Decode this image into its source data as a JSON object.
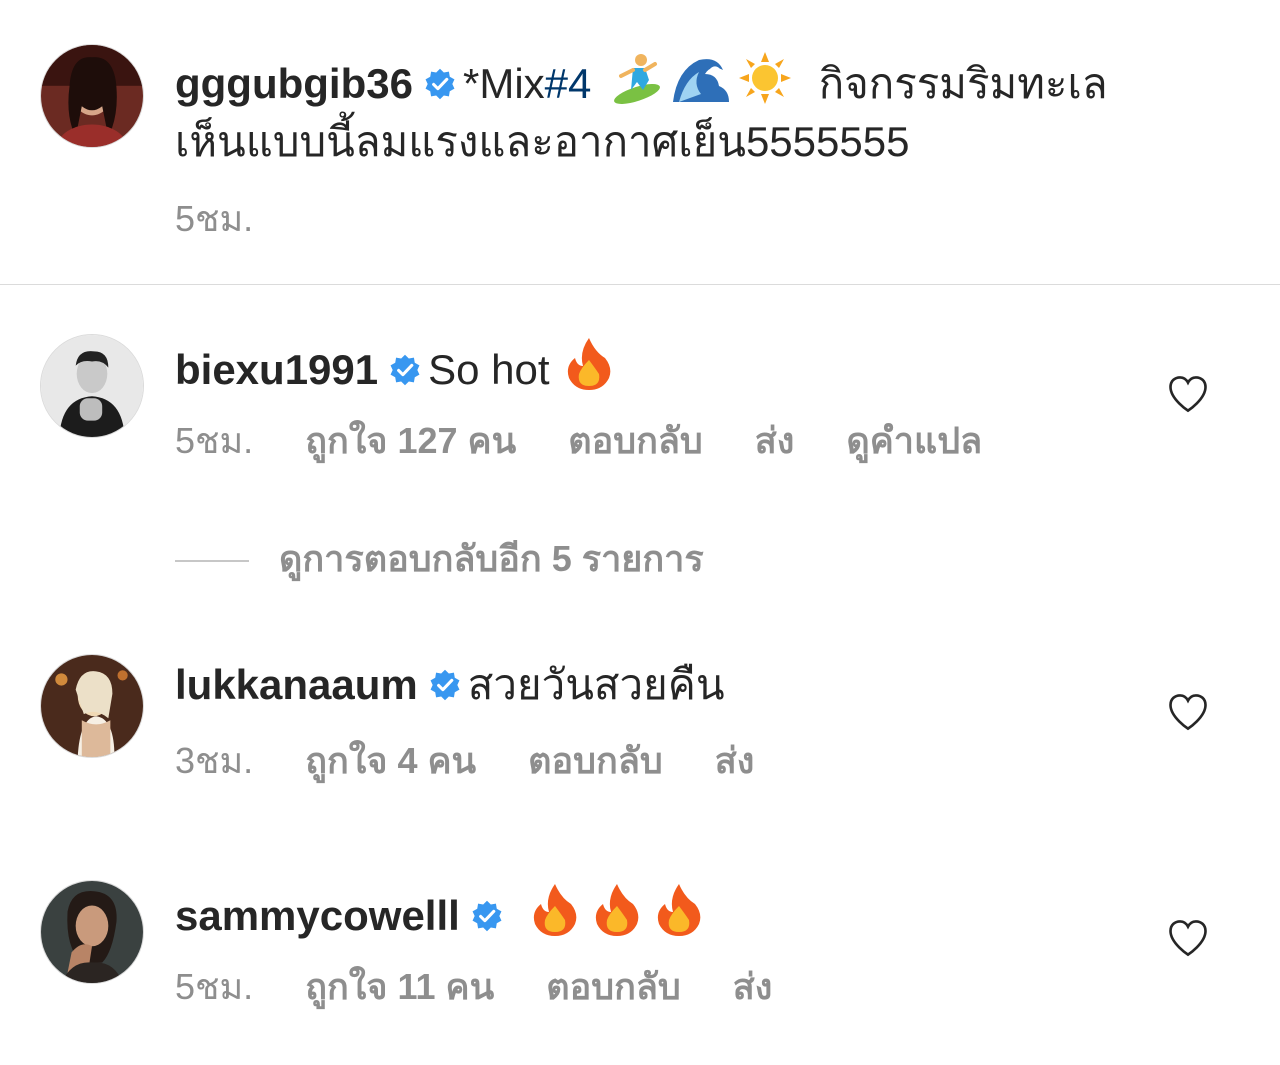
{
  "caption": {
    "username": "gggubgib36",
    "text_prefix": "*Mix",
    "hashtag": "#4",
    "text_after_emoji": "กิจกรรมริมทะเล",
    "line2": "เห็นแบบนี้ลมแรงและอากาศเย็น5555555",
    "time": "5ชม.",
    "emojis": [
      "surfer-emoji",
      "wave-emoji",
      "sun-emoji"
    ]
  },
  "comments": [
    {
      "username": "biexu1991",
      "text": "So hot",
      "emoji": "fire-emoji",
      "time": "5ชม.",
      "likes": "ถูกใจ 127 คน",
      "reply": "ตอบกลับ",
      "send": "ส่ง",
      "translate": "ดูคำแปล"
    },
    {
      "username": "lukkanaaum",
      "text": "สวยวันสวยคืน",
      "time": "3ชม.",
      "likes": "ถูกใจ 4 คน",
      "reply": "ตอบกลับ",
      "send": "ส่ง"
    },
    {
      "username": "sammycowelll",
      "text": "",
      "emoji": "fire-emoji",
      "time": "5ชม.",
      "likes": "ถูกใจ 11 คน",
      "reply": "ตอบกลับ",
      "send": "ส่ง"
    }
  ],
  "view_replies": "ดูการตอบกลับอีก 5 รายการ",
  "colors": {
    "verified": "#3897f0",
    "secondary_text": "#8e8e8e",
    "primary_text": "#262626",
    "hashtag": "#00376b"
  }
}
